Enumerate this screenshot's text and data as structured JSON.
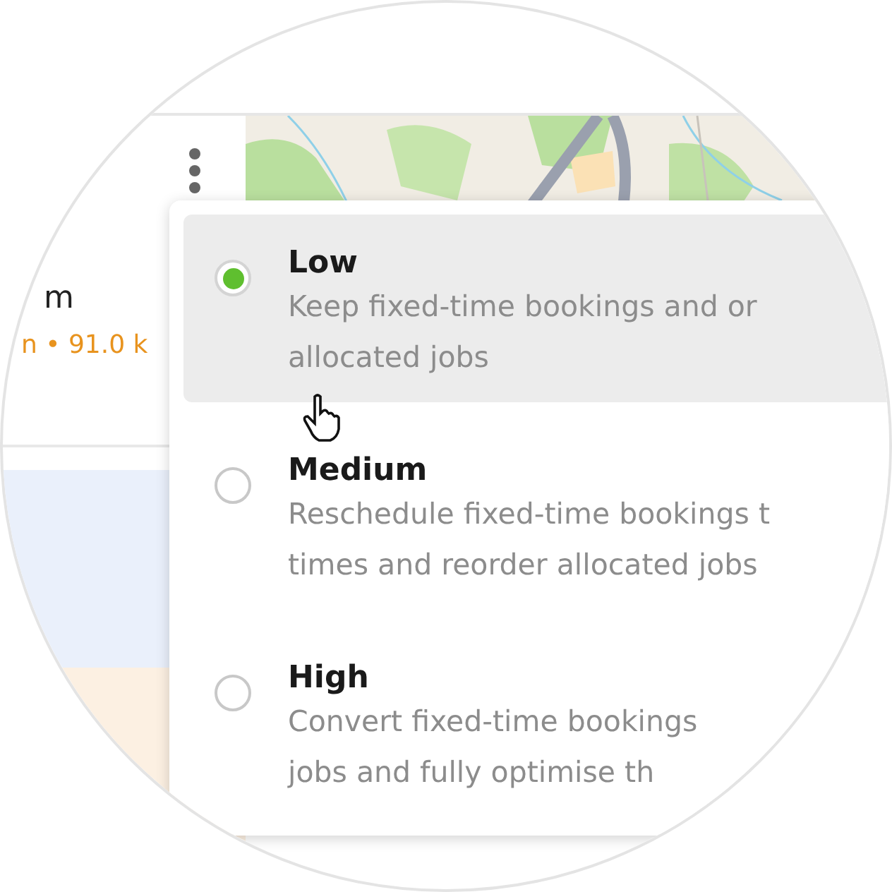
{
  "summary": {
    "title": "m",
    "stats": "n • 91.0 k"
  },
  "options": [
    {
      "label": "Low",
      "description": [
        "Keep fixed-time bookings and or",
        "allocated jobs"
      ],
      "selected": true,
      "hovered": true
    },
    {
      "label": "Medium",
      "description": [
        "Reschedule fixed-time bookings t",
        "times and reorder allocated jobs"
      ],
      "selected": false,
      "hovered": false
    },
    {
      "label": "High",
      "description": [
        "Convert fixed-time bookings",
        "jobs and fully optimise th"
      ],
      "selected": false,
      "hovered": false
    }
  ]
}
